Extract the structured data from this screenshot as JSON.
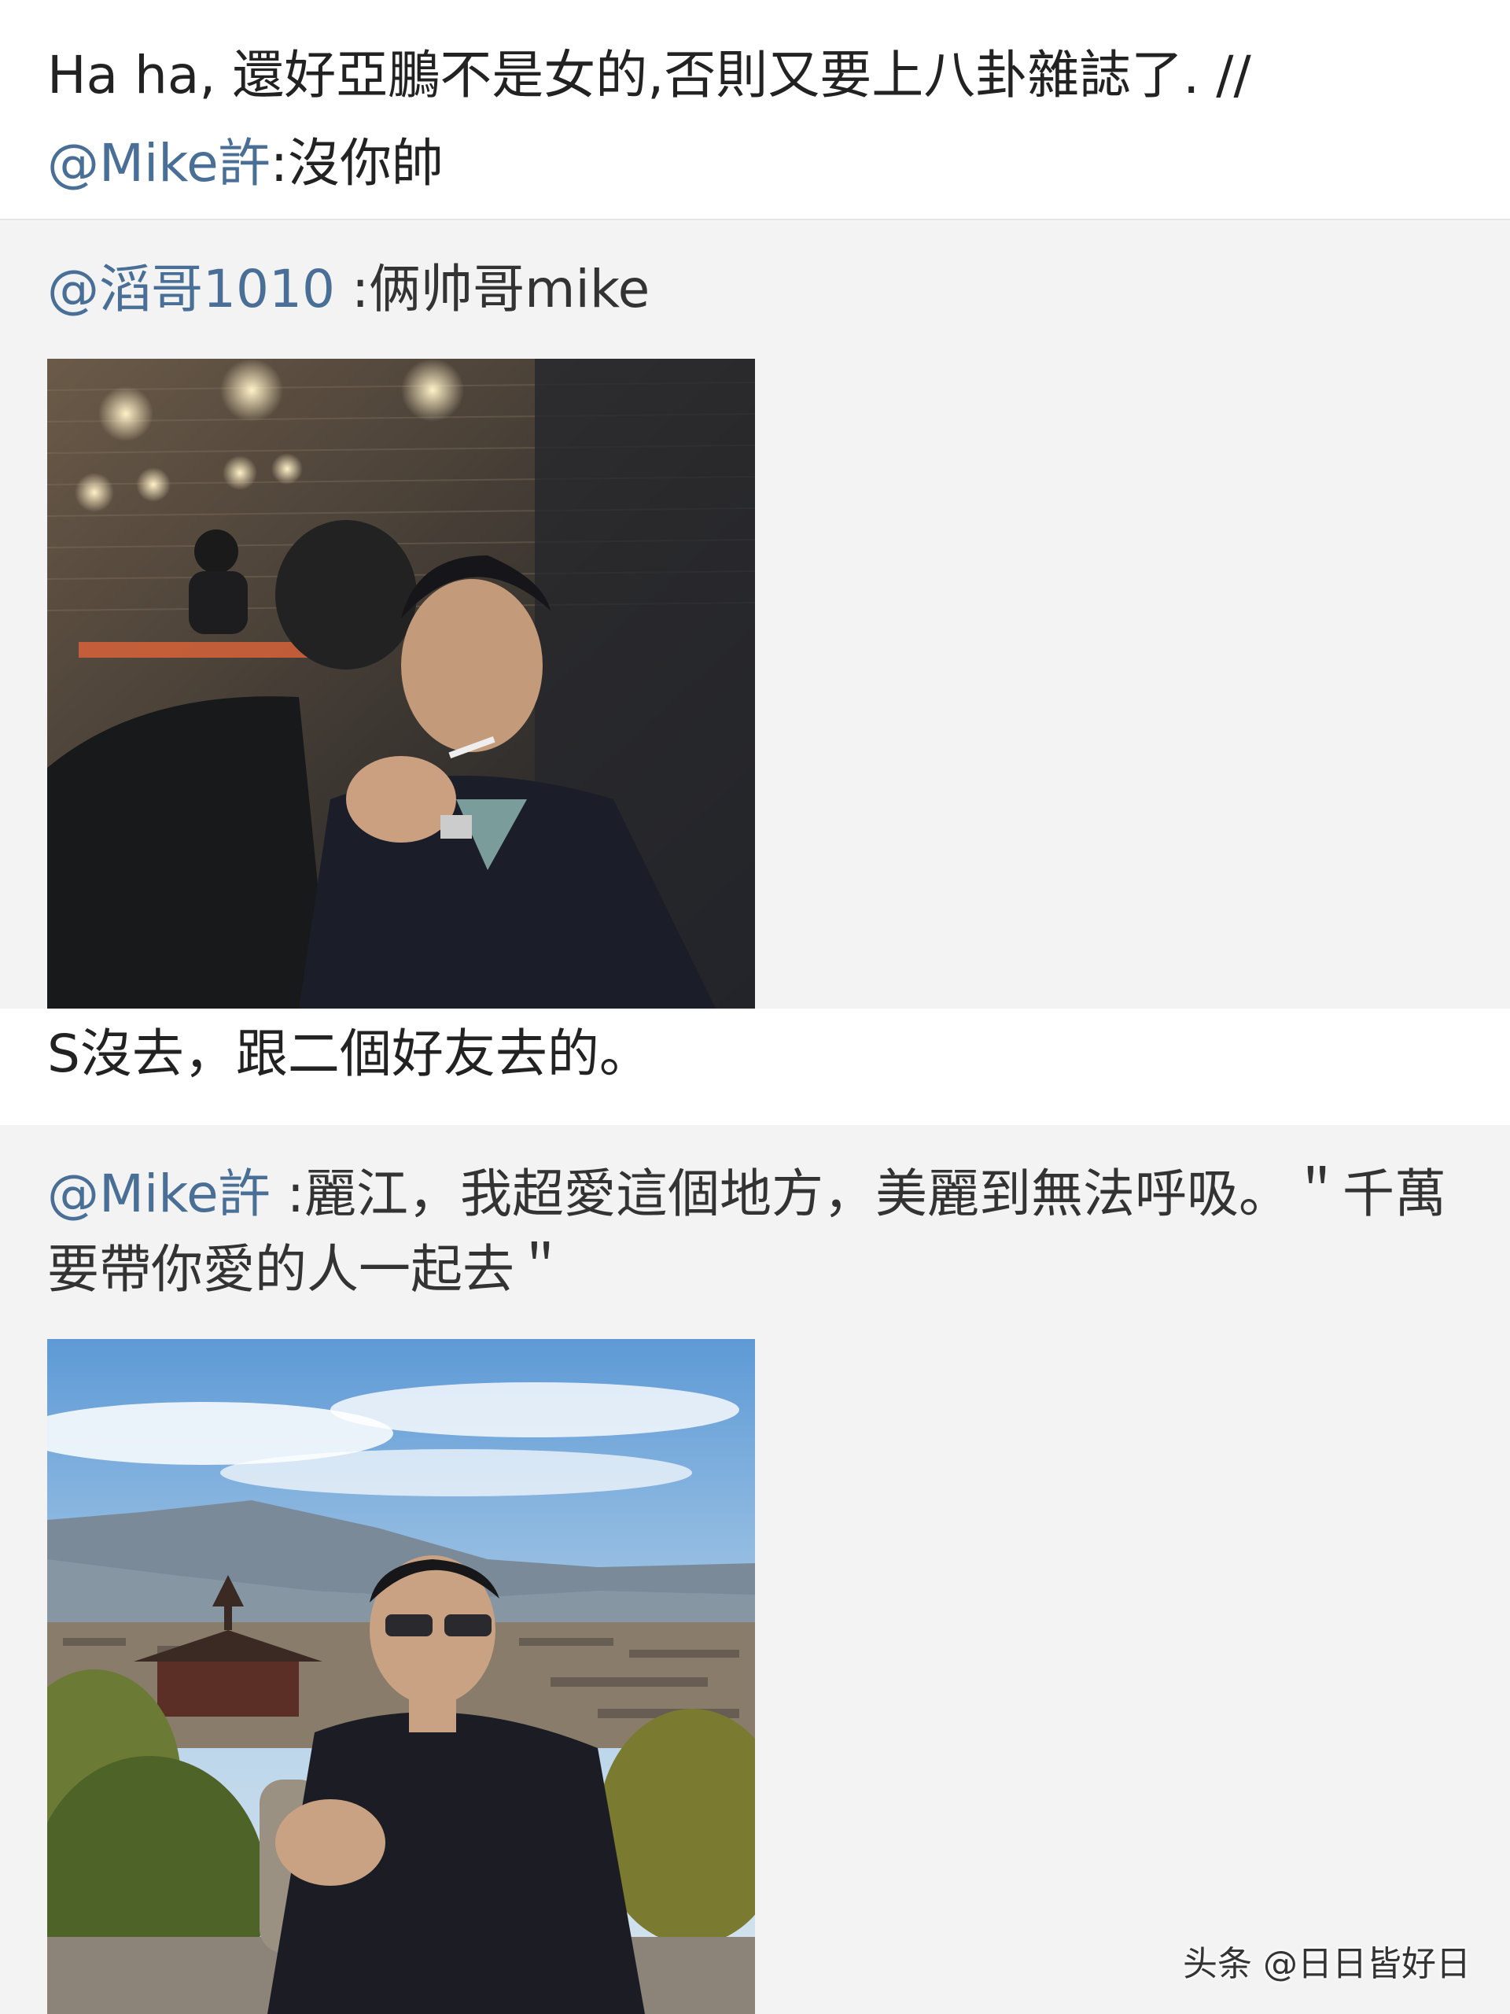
{
  "top_post": {
    "text": "Ha ha, 還好亞鵬不是女的,否則又要上八卦雜誌了. //",
    "mention": "@Mike許",
    "mention_text": ":沒你帥"
  },
  "repost1": {
    "mention": "@滔哥1010",
    "text": " :俩帅哥mike",
    "image_icon": "photo-bar-scene",
    "caption": "S沒去，跟二個好友去的。"
  },
  "repost2": {
    "mention": "@Mike許",
    "text": " :麗江，我超愛這個地方，美麗到無法呼吸。＂千萬要帶你愛的人一起去＂",
    "image_icon": "photo-lijiang-old-town"
  },
  "watermark": "头条 @日日皆好日",
  "colors": {
    "mention": "#4a6f97",
    "repost_bg": "#f3f3f3",
    "post_bg": "#ffffff"
  }
}
